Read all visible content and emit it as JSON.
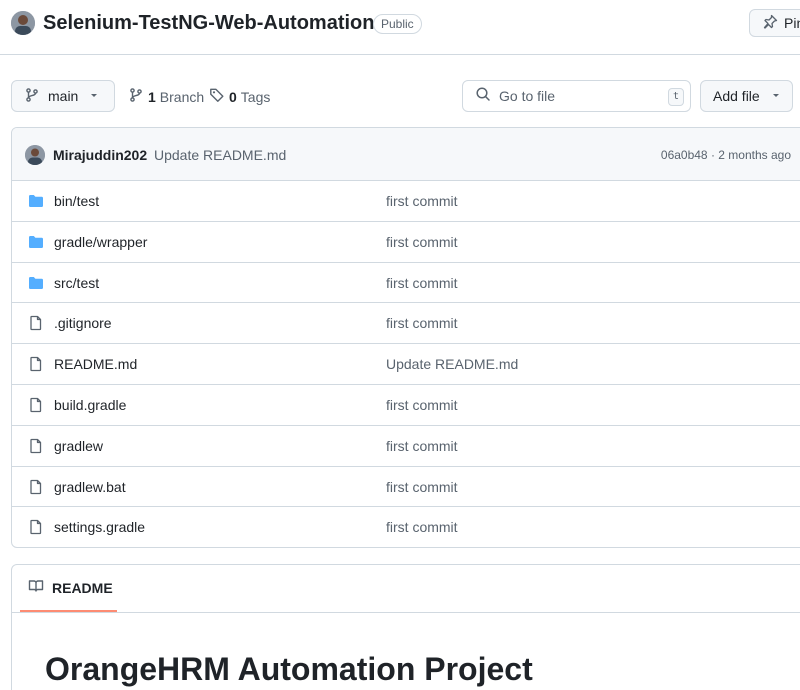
{
  "repo": {
    "name": "Selenium-TestNG-Web-Automation",
    "visibility": "Public",
    "pin_label": "Pin"
  },
  "toolbar": {
    "branch": "main",
    "branch_count": "1",
    "branch_label": "Branch",
    "tag_count": "0",
    "tag_label": "Tags",
    "goto_placeholder": "Go to file",
    "goto_shortcut": "t",
    "add_file_label": "Add file"
  },
  "latest_commit": {
    "author": "Mirajuddin202",
    "message": "Update README.md",
    "meta": "06a0b48 · 2 months ago"
  },
  "files": [
    {
      "name": "bin/test",
      "type": "folder",
      "commit": "first commit"
    },
    {
      "name": "gradle/wrapper",
      "type": "folder",
      "commit": "first commit"
    },
    {
      "name": "src/test",
      "type": "folder",
      "commit": "first commit"
    },
    {
      "name": ".gitignore",
      "type": "file",
      "commit": "first commit"
    },
    {
      "name": "README.md",
      "type": "file",
      "commit": "Update README.md"
    },
    {
      "name": "build.gradle",
      "type": "file",
      "commit": "first commit"
    },
    {
      "name": "gradlew",
      "type": "file",
      "commit": "first commit"
    },
    {
      "name": "gradlew.bat",
      "type": "file",
      "commit": "first commit"
    },
    {
      "name": "settings.gradle",
      "type": "file",
      "commit": "first commit"
    }
  ],
  "readme": {
    "tab_label": "README",
    "title": "OrangeHRM Automation Project"
  },
  "colors": {
    "folder": "#54aeff",
    "file_icon": "#59636e",
    "tab_underline": "#fd8c73"
  }
}
